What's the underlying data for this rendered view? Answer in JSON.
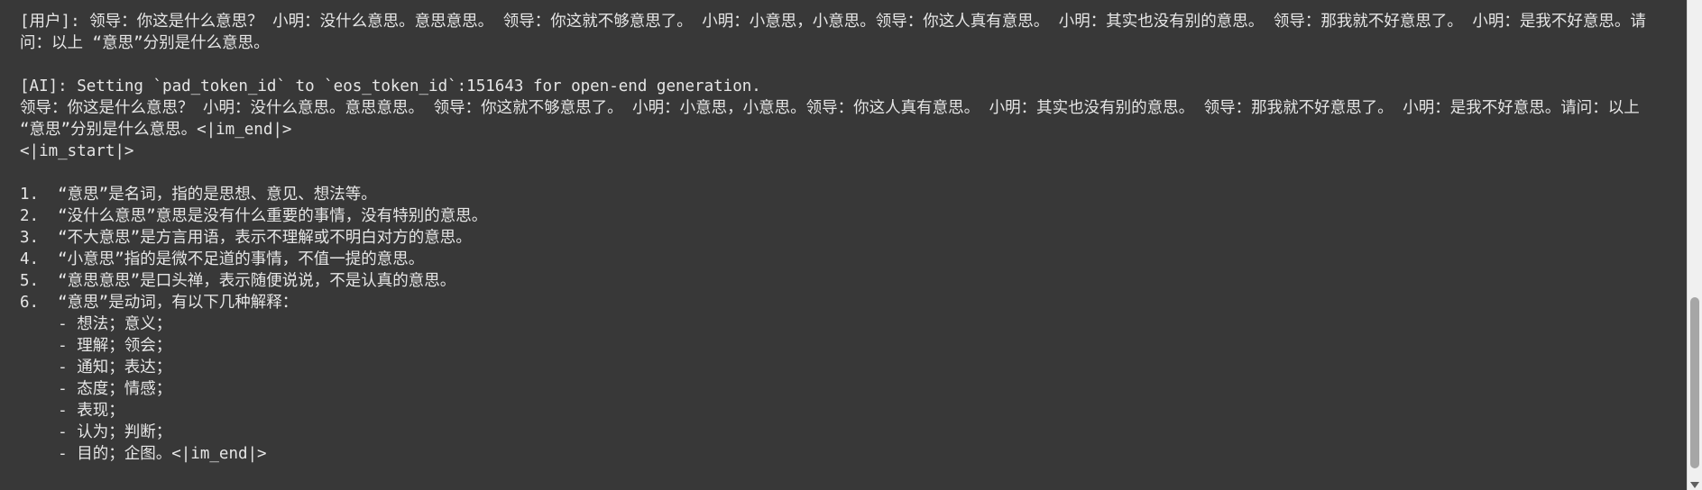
{
  "conversation": {
    "user_line_1": "[用户]: 领导：你这是什么意思？ 小明：没什么意思。意思意思。 领导：你这就不够意思了。 小明：小意思，小意思。领导：你这人真有意思。 小明：其实也没有别的意思。 领导：那我就不好意思了。 小明：是我不好意思。请问：以上 “意思”分别是什么意思。",
    "ai_line_1": "[AI]: Setting `pad_token_id` to `eos_token_id`:151643 for open-end generation.",
    "ai_line_2": "领导：你这是什么意思？ 小明：没什么意思。意思意思。 领导：你这就不够意思了。 小明：小意思，小意思。领导：你这人真有意思。 小明：其实也没有别的意思。 领导：那我就不好意思了。 小明：是我不好意思。请问：以上 “意思”分别是什么意思。<|im_end|>",
    "ai_line_3": "<|im_start|>",
    "answer": [
      "1.  “意思”是名词，指的是思想、意见、想法等。",
      "2.  “没什么意思”意思是没有什么重要的事情，没有特别的意思。",
      "3.  “不大意思”是方言用语，表示不理解或不明白对方的意思。",
      "4.  “小意思”指的是微不足道的事情，不值一提的意思。",
      "5.  “意思意思”是口头禅，表示随便说说，不是认真的意思。",
      "6.  “意思”是动词，有以下几种解释：",
      "    - 想法；意义；",
      "    - 理解；领会；",
      "    - 通知；表达；",
      "    - 态度；情感；",
      "    - 表现；",
      "    - 认为；判断；",
      "    - 目的；企图。<|im_end|>"
    ]
  }
}
